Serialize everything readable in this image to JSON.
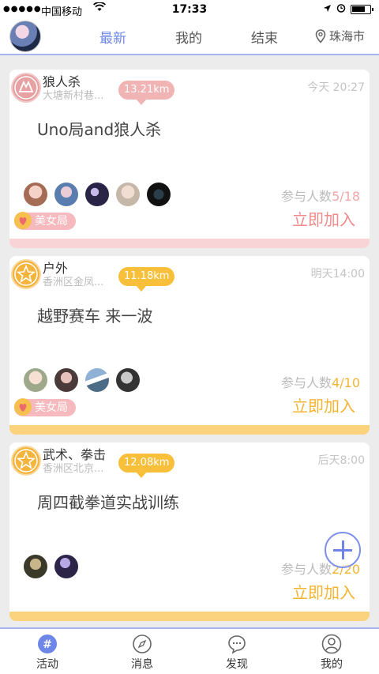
{
  "status": {
    "signal": "●●●●●",
    "carrier": "中国移动",
    "time": "17:33"
  },
  "header": {
    "tabs": [
      {
        "label": "最新",
        "active": true
      },
      {
        "label": "我的",
        "active": false
      },
      {
        "label": "结束",
        "active": false
      }
    ],
    "city": "珠海市"
  },
  "cards": [
    {
      "category": "狼人杀",
      "address": "大塘新村巷...",
      "distance": "13.21km",
      "time": "今天 20:27",
      "title": "Uno局and狼人杀",
      "count_label": "参与人数",
      "count": "5/18",
      "join": "立即加入",
      "badge": "美女局",
      "theme": "red"
    },
    {
      "category": "户外",
      "address": "香洲区金凤...",
      "distance": "11.18km",
      "time": "明天14:00",
      "title": "越野赛车 来一波",
      "count_label": "参与人数",
      "count": "4/10",
      "join": "立即加入",
      "badge": "美女局",
      "theme": "orange"
    },
    {
      "category": "武术、拳击",
      "address": "香洲区北京...",
      "distance": "12.08km",
      "time": "后天8:00",
      "title": "周四截拳道实战训练",
      "count_label": "参与人数",
      "count": "2/20",
      "join": "立即加入",
      "theme": "orange"
    }
  ],
  "tabbar": [
    {
      "label": "活动",
      "icon": "hashtag-icon",
      "active": true
    },
    {
      "label": "消息",
      "icon": "compass-icon",
      "active": false
    },
    {
      "label": "发现",
      "icon": "chat-bubble-icon",
      "active": false
    },
    {
      "label": "我的",
      "icon": "user-icon",
      "active": false
    }
  ],
  "colors": {
    "accent": "#6e86e8",
    "red_theme": "#f0b4b5",
    "orange_theme": "#f8bf3a"
  }
}
